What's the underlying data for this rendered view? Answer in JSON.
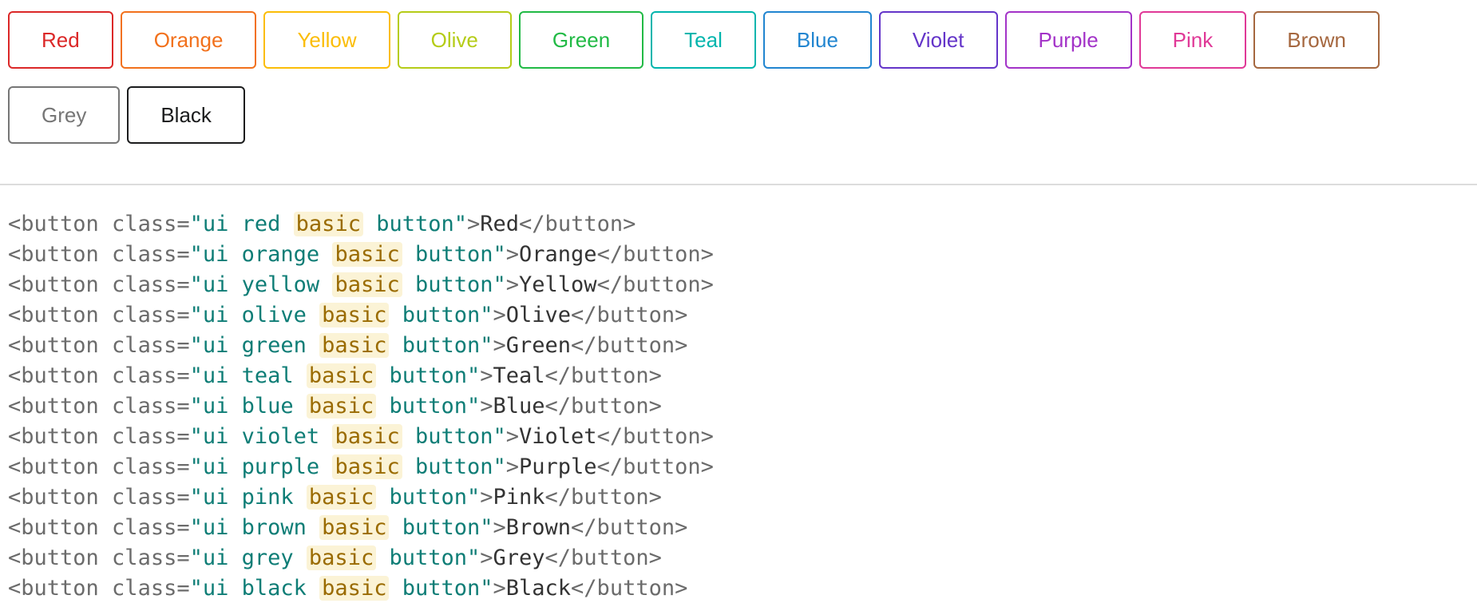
{
  "buttons": [
    {
      "label": "Red",
      "color": "#db2828"
    },
    {
      "label": "Orange",
      "color": "#f2711c"
    },
    {
      "label": "Yellow",
      "color": "#fbbd08"
    },
    {
      "label": "Olive",
      "color": "#b5cc18"
    },
    {
      "label": "Green",
      "color": "#21ba45"
    },
    {
      "label": "Teal",
      "color": "#00b5ad"
    },
    {
      "label": "Blue",
      "color": "#2185d0"
    },
    {
      "label": "Violet",
      "color": "#6435c9"
    },
    {
      "label": "Purple",
      "color": "#a333c8"
    },
    {
      "label": "Pink",
      "color": "#e03997"
    },
    {
      "label": "Brown",
      "color": "#a5673f"
    },
    {
      "label": "Grey",
      "color": "#767676"
    },
    {
      "label": "Black",
      "color": "#1b1c1d"
    }
  ],
  "code": {
    "open_tag": "<button",
    "attr": " class=",
    "str_prefix": "\"ui ",
    "highlight": "basic",
    "str_suffix": " button\"",
    "close_angle": ">",
    "end_tag": "</button>",
    "lines": [
      {
        "color_class": "red",
        "text": "Red"
      },
      {
        "color_class": "orange",
        "text": "Orange"
      },
      {
        "color_class": "yellow",
        "text": "Yellow"
      },
      {
        "color_class": "olive",
        "text": "Olive"
      },
      {
        "color_class": "green",
        "text": "Green"
      },
      {
        "color_class": "teal",
        "text": "Teal"
      },
      {
        "color_class": "blue",
        "text": "Blue"
      },
      {
        "color_class": "violet",
        "text": "Violet"
      },
      {
        "color_class": "purple",
        "text": "Purple"
      },
      {
        "color_class": "pink",
        "text": "Pink"
      },
      {
        "color_class": "brown",
        "text": "Brown"
      },
      {
        "color_class": "grey",
        "text": "Grey"
      },
      {
        "color_class": "black",
        "text": "Black"
      }
    ]
  }
}
